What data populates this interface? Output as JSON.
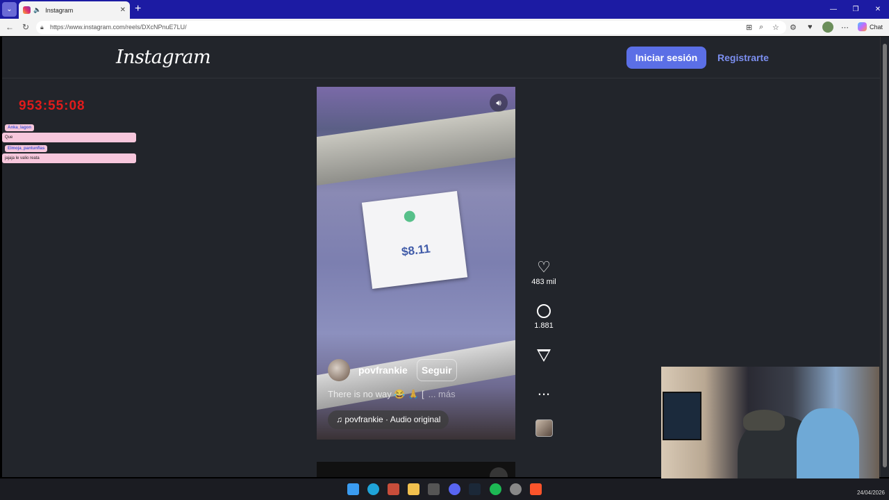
{
  "browser": {
    "tab_title": "Instagram",
    "url": "https://www.instagram.com/reels/DXcNPnuE7LU/",
    "chat_label": "Chat"
  },
  "header": {
    "logo": "Instagram",
    "login_label": "Iniciar sesión",
    "signup_label": "Registrarte"
  },
  "overlay": {
    "timer": "953:55:08",
    "messages": [
      {
        "user": "Anka_lagon",
        "text": "Que"
      },
      {
        "user": "Elmoja_pantunflas",
        "text": "jajaja le valio reata"
      }
    ]
  },
  "reel": {
    "price_tag": "$8.11",
    "author": "povfrankie",
    "follow_label": "Seguir",
    "caption": "There is no way 😂 🙏 [",
    "caption_more": "... más",
    "audio": "povfrankie · Audio original"
  },
  "actions": {
    "likes": "483 mil",
    "comments": "1.881",
    "more": "..."
  },
  "taskbar": {
    "date": "24/04/2026"
  }
}
